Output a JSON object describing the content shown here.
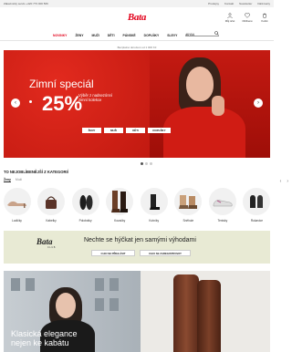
{
  "topbar": {
    "left": "Zákaznický servis +420 773 000 566",
    "links": [
      "Prodejny",
      "Kontakt",
      "Newsletter",
      "Dárk.karty"
    ]
  },
  "header": {
    "logo": "Bata",
    "icons": [
      {
        "name": "account-icon",
        "label": "Můj účet"
      },
      {
        "name": "wishlist-icon",
        "label": "Oblíbené"
      },
      {
        "name": "cart-icon",
        "label": "Košík"
      }
    ]
  },
  "nav": {
    "items": [
      "NOVINKY",
      "ŽENY",
      "MUŽI",
      "DĚTI",
      "PÁNSKÉ",
      "DOPLŇKY",
      "SLEVY",
      "BLOG"
    ],
    "search_placeholder": "Hledat"
  },
  "subheader": "Bezplatné doručení od 1 000 Kč",
  "hero": {
    "title": "Zimní speciál",
    "percent": "25%",
    "description": "Výběr z nadsezónní zimní kolekce",
    "buttons": [
      "ŽENY",
      "MUŽI",
      "DĚTI",
      "DOPLŇKY"
    ],
    "slide_count": 3,
    "active_slide": 0
  },
  "categories": {
    "heading": "TO NEJOBLÍBENĚJŠÍ Z KATEGORIÍ",
    "tabs": [
      "Ženy",
      "Muži"
    ],
    "items": [
      {
        "label": "Lodičky",
        "icon": "pump-shoe-icon"
      },
      {
        "label": "Kabelky",
        "icon": "handbag-icon"
      },
      {
        "label": "Polobotky",
        "icon": "loafer-icon"
      },
      {
        "label": "Kozačky",
        "icon": "tall-boot-icon"
      },
      {
        "label": "Kotníky",
        "icon": "ankle-boot-icon"
      },
      {
        "label": "Sněhule",
        "icon": "snow-boot-icon"
      },
      {
        "label": "Tenisky",
        "icon": "sneaker-icon"
      },
      {
        "label": "Rukavice",
        "icon": "gloves-icon"
      }
    ]
  },
  "club": {
    "logo": "Bata",
    "sub": "CLUB",
    "text": "Nechte se hýčkat jen samými výhodami",
    "buttons": [
      "CHCI SE PŘIHLÁSIT",
      "CHCI SE ZAREGISTROVAT"
    ]
  },
  "promo": {
    "title_line1": "Klasická elegance",
    "title_line2": "nejen ke kabátu"
  },
  "colors": {
    "brand_red": "#e2001a",
    "club_bg": "#e8ead4"
  }
}
